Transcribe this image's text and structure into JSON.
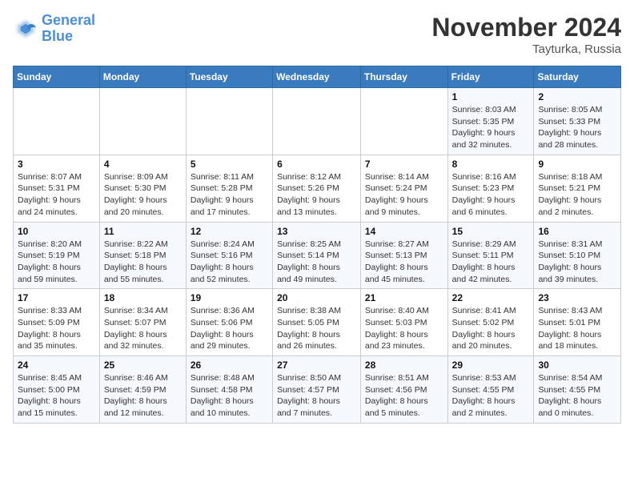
{
  "logo": {
    "line1": "General",
    "line2": "Blue"
  },
  "title": "November 2024",
  "location": "Tayturka, Russia",
  "days_header": [
    "Sunday",
    "Monday",
    "Tuesday",
    "Wednesday",
    "Thursday",
    "Friday",
    "Saturday"
  ],
  "weeks": [
    [
      {
        "day": "",
        "sunrise": "",
        "sunset": "",
        "daylight": ""
      },
      {
        "day": "",
        "sunrise": "",
        "sunset": "",
        "daylight": ""
      },
      {
        "day": "",
        "sunrise": "",
        "sunset": "",
        "daylight": ""
      },
      {
        "day": "",
        "sunrise": "",
        "sunset": "",
        "daylight": ""
      },
      {
        "day": "",
        "sunrise": "",
        "sunset": "",
        "daylight": ""
      },
      {
        "day": "1",
        "sunrise": "Sunrise: 8:03 AM",
        "sunset": "Sunset: 5:35 PM",
        "daylight": "Daylight: 9 hours and 32 minutes."
      },
      {
        "day": "2",
        "sunrise": "Sunrise: 8:05 AM",
        "sunset": "Sunset: 5:33 PM",
        "daylight": "Daylight: 9 hours and 28 minutes."
      }
    ],
    [
      {
        "day": "3",
        "sunrise": "Sunrise: 8:07 AM",
        "sunset": "Sunset: 5:31 PM",
        "daylight": "Daylight: 9 hours and 24 minutes."
      },
      {
        "day": "4",
        "sunrise": "Sunrise: 8:09 AM",
        "sunset": "Sunset: 5:30 PM",
        "daylight": "Daylight: 9 hours and 20 minutes."
      },
      {
        "day": "5",
        "sunrise": "Sunrise: 8:11 AM",
        "sunset": "Sunset: 5:28 PM",
        "daylight": "Daylight: 9 hours and 17 minutes."
      },
      {
        "day": "6",
        "sunrise": "Sunrise: 8:12 AM",
        "sunset": "Sunset: 5:26 PM",
        "daylight": "Daylight: 9 hours and 13 minutes."
      },
      {
        "day": "7",
        "sunrise": "Sunrise: 8:14 AM",
        "sunset": "Sunset: 5:24 PM",
        "daylight": "Daylight: 9 hours and 9 minutes."
      },
      {
        "day": "8",
        "sunrise": "Sunrise: 8:16 AM",
        "sunset": "Sunset: 5:23 PM",
        "daylight": "Daylight: 9 hours and 6 minutes."
      },
      {
        "day": "9",
        "sunrise": "Sunrise: 8:18 AM",
        "sunset": "Sunset: 5:21 PM",
        "daylight": "Daylight: 9 hours and 2 minutes."
      }
    ],
    [
      {
        "day": "10",
        "sunrise": "Sunrise: 8:20 AM",
        "sunset": "Sunset: 5:19 PM",
        "daylight": "Daylight: 8 hours and 59 minutes."
      },
      {
        "day": "11",
        "sunrise": "Sunrise: 8:22 AM",
        "sunset": "Sunset: 5:18 PM",
        "daylight": "Daylight: 8 hours and 55 minutes."
      },
      {
        "day": "12",
        "sunrise": "Sunrise: 8:24 AM",
        "sunset": "Sunset: 5:16 PM",
        "daylight": "Daylight: 8 hours and 52 minutes."
      },
      {
        "day": "13",
        "sunrise": "Sunrise: 8:25 AM",
        "sunset": "Sunset: 5:14 PM",
        "daylight": "Daylight: 8 hours and 49 minutes."
      },
      {
        "day": "14",
        "sunrise": "Sunrise: 8:27 AM",
        "sunset": "Sunset: 5:13 PM",
        "daylight": "Daylight: 8 hours and 45 minutes."
      },
      {
        "day": "15",
        "sunrise": "Sunrise: 8:29 AM",
        "sunset": "Sunset: 5:11 PM",
        "daylight": "Daylight: 8 hours and 42 minutes."
      },
      {
        "day": "16",
        "sunrise": "Sunrise: 8:31 AM",
        "sunset": "Sunset: 5:10 PM",
        "daylight": "Daylight: 8 hours and 39 minutes."
      }
    ],
    [
      {
        "day": "17",
        "sunrise": "Sunrise: 8:33 AM",
        "sunset": "Sunset: 5:09 PM",
        "daylight": "Daylight: 8 hours and 35 minutes."
      },
      {
        "day": "18",
        "sunrise": "Sunrise: 8:34 AM",
        "sunset": "Sunset: 5:07 PM",
        "daylight": "Daylight: 8 hours and 32 minutes."
      },
      {
        "day": "19",
        "sunrise": "Sunrise: 8:36 AM",
        "sunset": "Sunset: 5:06 PM",
        "daylight": "Daylight: 8 hours and 29 minutes."
      },
      {
        "day": "20",
        "sunrise": "Sunrise: 8:38 AM",
        "sunset": "Sunset: 5:05 PM",
        "daylight": "Daylight: 8 hours and 26 minutes."
      },
      {
        "day": "21",
        "sunrise": "Sunrise: 8:40 AM",
        "sunset": "Sunset: 5:03 PM",
        "daylight": "Daylight: 8 hours and 23 minutes."
      },
      {
        "day": "22",
        "sunrise": "Sunrise: 8:41 AM",
        "sunset": "Sunset: 5:02 PM",
        "daylight": "Daylight: 8 hours and 20 minutes."
      },
      {
        "day": "23",
        "sunrise": "Sunrise: 8:43 AM",
        "sunset": "Sunset: 5:01 PM",
        "daylight": "Daylight: 8 hours and 18 minutes."
      }
    ],
    [
      {
        "day": "24",
        "sunrise": "Sunrise: 8:45 AM",
        "sunset": "Sunset: 5:00 PM",
        "daylight": "Daylight: 8 hours and 15 minutes."
      },
      {
        "day": "25",
        "sunrise": "Sunrise: 8:46 AM",
        "sunset": "Sunset: 4:59 PM",
        "daylight": "Daylight: 8 hours and 12 minutes."
      },
      {
        "day": "26",
        "sunrise": "Sunrise: 8:48 AM",
        "sunset": "Sunset: 4:58 PM",
        "daylight": "Daylight: 8 hours and 10 minutes."
      },
      {
        "day": "27",
        "sunrise": "Sunrise: 8:50 AM",
        "sunset": "Sunset: 4:57 PM",
        "daylight": "Daylight: 8 hours and 7 minutes."
      },
      {
        "day": "28",
        "sunrise": "Sunrise: 8:51 AM",
        "sunset": "Sunset: 4:56 PM",
        "daylight": "Daylight: 8 hours and 5 minutes."
      },
      {
        "day": "29",
        "sunrise": "Sunrise: 8:53 AM",
        "sunset": "Sunset: 4:55 PM",
        "daylight": "Daylight: 8 hours and 2 minutes."
      },
      {
        "day": "30",
        "sunrise": "Sunrise: 8:54 AM",
        "sunset": "Sunset: 4:55 PM",
        "daylight": "Daylight: 8 hours and 0 minutes."
      }
    ]
  ]
}
